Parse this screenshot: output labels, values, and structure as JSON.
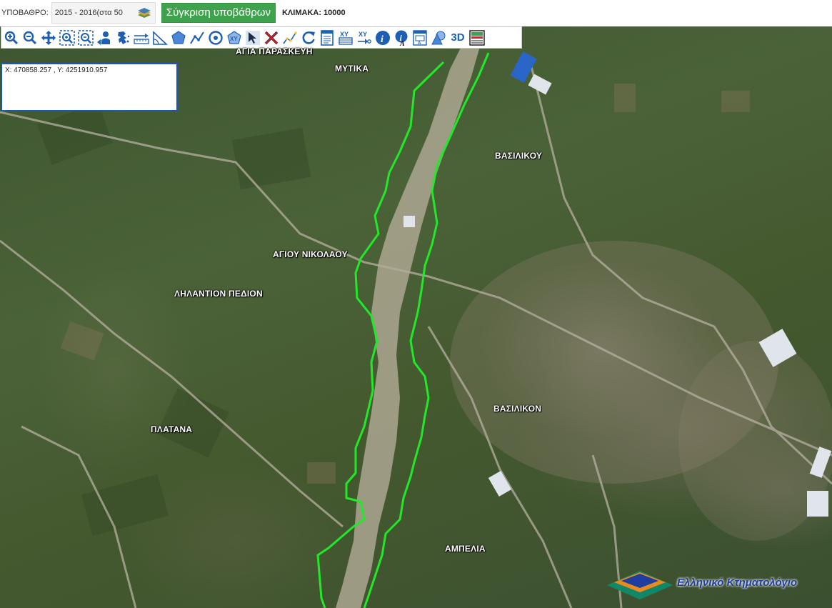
{
  "topbar": {
    "basemap_label": "ΥΠΟΒΑΘΡΟ:",
    "basemap_value": "2015 - 2016(στα 50",
    "compare_button": "Σύγκριση υποβάθρων",
    "scale": "ΚΛΙΜΑΚΑ: 10000"
  },
  "toolbar": {
    "tools": [
      {
        "name": "zoom-in-tool",
        "icon": "magnifier-plus-icon"
      },
      {
        "name": "zoom-out-tool",
        "icon": "magnifier-minus-icon"
      },
      {
        "name": "pan-tool",
        "icon": "move-arrows-icon"
      },
      {
        "name": "zoom-box-in-tool",
        "icon": "zoom-box-in-icon"
      },
      {
        "name": "zoom-box-out-tool",
        "icon": "zoom-box-out-icon"
      },
      {
        "name": "previous-view-tool",
        "icon": "user-arrow-icon"
      },
      {
        "name": "full-extent-tool",
        "icon": "greece-map-icon"
      },
      {
        "name": "measure-distance-tool",
        "icon": "ruler-icon"
      },
      {
        "name": "measure-angle-tool",
        "icon": "triangle-ruler-icon"
      },
      {
        "name": "draw-polygon-tool",
        "icon": "polygon-icon"
      },
      {
        "name": "draw-line-tool",
        "icon": "polyline-icon"
      },
      {
        "name": "draw-point-tool",
        "icon": "target-icon"
      },
      {
        "name": "draw-shape-xy-tool",
        "icon": "shape-xy-icon"
      },
      {
        "name": "select-tool",
        "icon": "cursor-select-icon"
      },
      {
        "name": "clear-tool",
        "icon": "red-x-icon"
      },
      {
        "name": "edit-vertices-tool",
        "icon": "pen-vertices-icon"
      },
      {
        "name": "refresh-tool",
        "icon": "refresh-icon"
      },
      {
        "name": "list-tool",
        "icon": "document-list-icon"
      },
      {
        "name": "xy-table-tool",
        "icon": "xy-table-icon"
      },
      {
        "name": "goto-xy-tool",
        "icon": "xy-arrow-icon"
      },
      {
        "name": "info-tool",
        "icon": "info-icon"
      },
      {
        "name": "info-label-tool",
        "icon": "info-text-icon"
      },
      {
        "name": "print-tool",
        "icon": "print-page-icon"
      },
      {
        "name": "layers-tool",
        "icon": "layer-shapes-icon"
      },
      {
        "name": "3d-tool",
        "icon": "3d-text-icon",
        "label": "3D"
      },
      {
        "name": "legend-tool",
        "icon": "legend-icon"
      }
    ]
  },
  "coordinates": "X: 470858.257 , Y: 4251910.957",
  "places": {
    "agia_paraskevi": "ΑΓΙΑ ΠΑΡΑΣΚΕΥΗ",
    "mytika": "ΜΥΤΙΚΑ",
    "vasilikou": "ΒΑΣΙΛΙΚΟΥ",
    "agiou_nikolaou": "ΑΓΙΟΥ ΝΙΚΟΛΑΟΥ",
    "lilantion": "ΛΗΛΑΝΤΙΟΝ ΠΕΔΙΟΝ",
    "vasilikon": "ΒΑΣΙΛΙΚΟΝ",
    "platana": "ΠΛΑΤΑΝΑ",
    "ampelia": "ΑΜΠΕΛΙΑ"
  },
  "logo_text": "Ελληνικό Κτηματολόγιο",
  "colors": {
    "accent_green": "#3fa34d",
    "boundary_line": "#22e82a",
    "toolbar_blue": "#1d5fb3",
    "coord_border": "#1f56b0"
  }
}
